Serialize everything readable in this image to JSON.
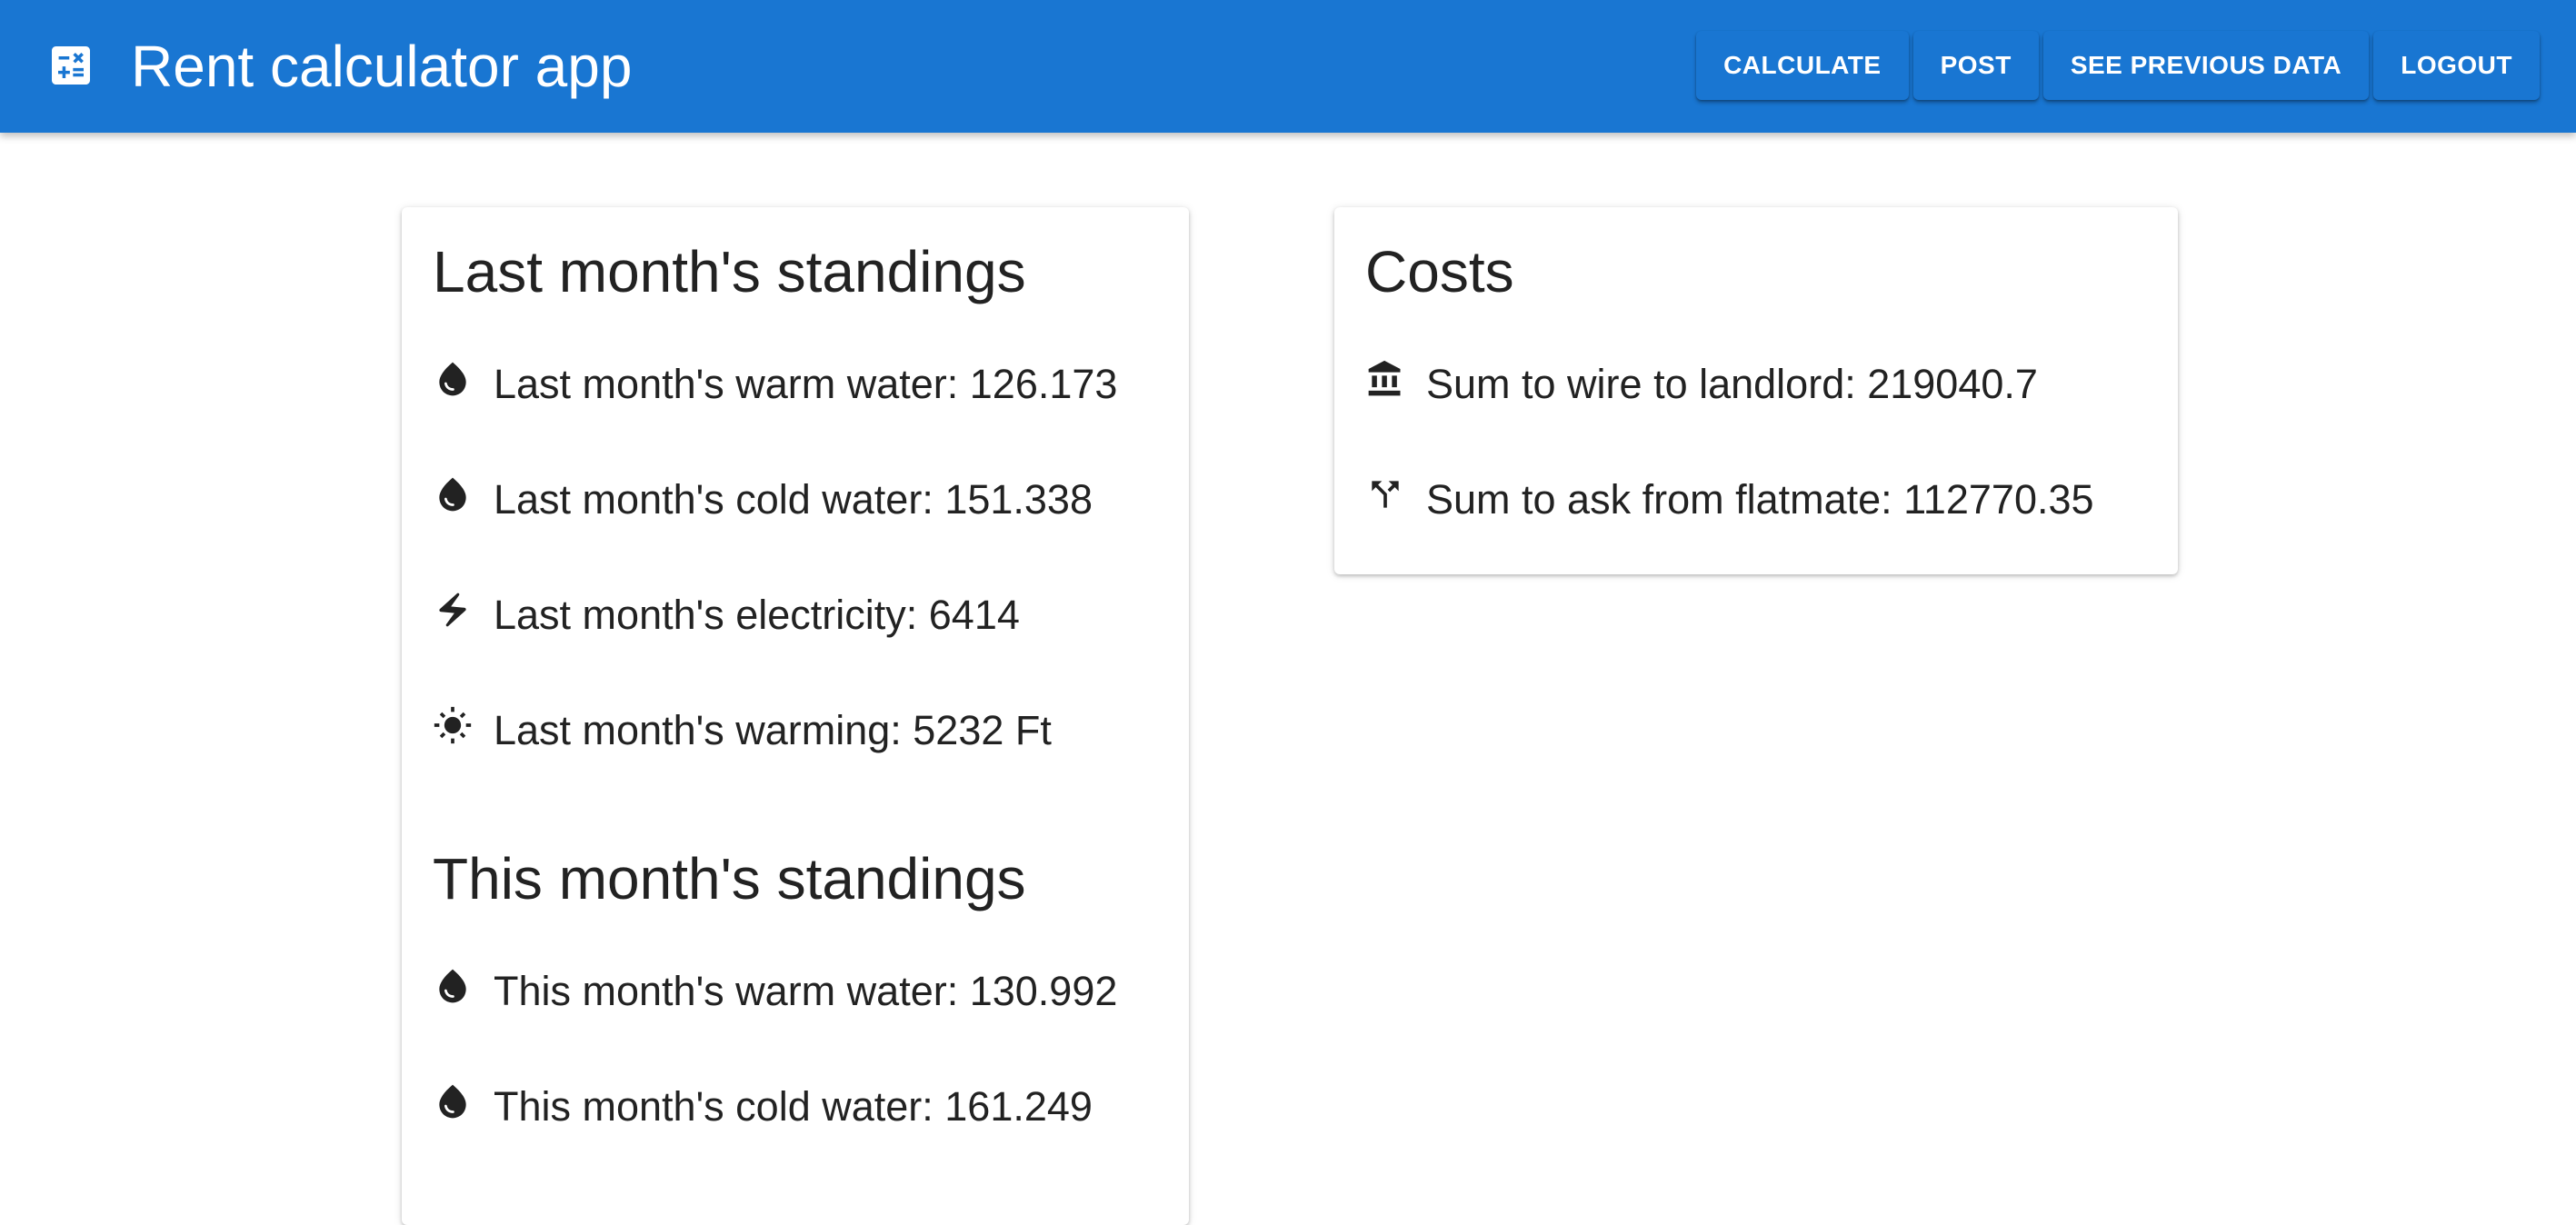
{
  "header": {
    "title": "Rent calculator app",
    "app_icon": "calculator-icon",
    "nav": [
      "CALCULATE",
      "POST",
      "SEE PREVIOUS DATA",
      "LOGOUT"
    ]
  },
  "last_month": {
    "title": "Last month's standings",
    "items": [
      {
        "icon": "water-drop-icon",
        "label": "Last month's warm water: 126.173"
      },
      {
        "icon": "water-drop-icon",
        "label": "Last month's cold water: 151.338"
      },
      {
        "icon": "bolt-icon",
        "label": "Last month's electricity: 6414"
      },
      {
        "icon": "sun-icon",
        "label": "Last month's warming: 5232 Ft"
      }
    ]
  },
  "this_month": {
    "title": "This month's standings",
    "items": [
      {
        "icon": "water-drop-icon",
        "label": "This month's warm water: 130.992"
      },
      {
        "icon": "water-drop-icon",
        "label": "This month's cold water: 161.249"
      }
    ]
  },
  "costs": {
    "title": "Costs",
    "items": [
      {
        "icon": "bank-icon",
        "label": "Sum to wire to landlord: 219040.7"
      },
      {
        "icon": "call-split-icon",
        "label": "Sum to ask from flatmate: 112770.35"
      }
    ]
  },
  "colors": {
    "appbar": "#1976d2",
    "text": "#222222",
    "background": "#ffffff"
  }
}
